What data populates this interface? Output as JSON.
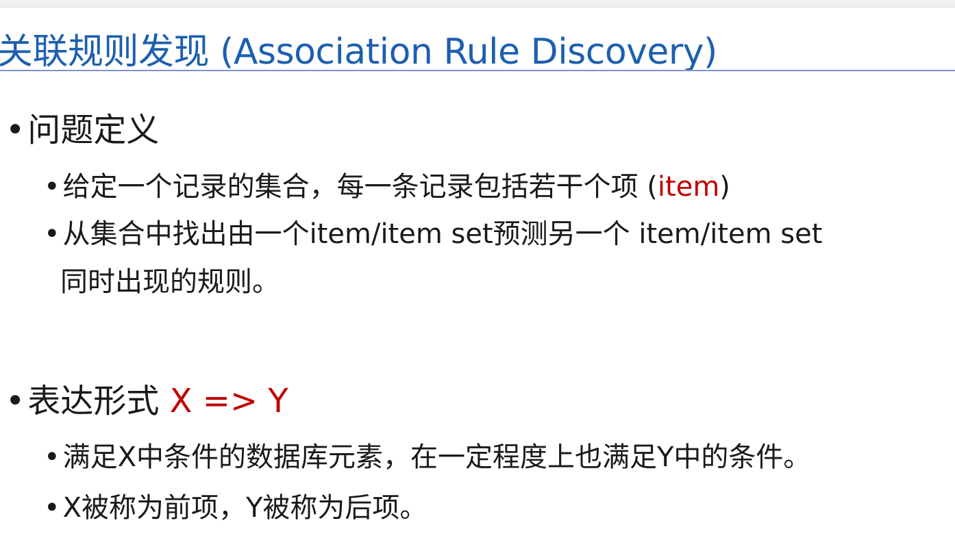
{
  "slide": {
    "title": "关联规则发现 (Association Rule Discovery)"
  },
  "section1": {
    "heading": "问题定义",
    "items": [
      {
        "text": "给定一个记录的集合，每一条记录包括若干个项 (",
        "highlight": "item",
        "suffix": ")"
      },
      {
        "line1": "从集合中找出由一个item/item set预测另一个 item/item set",
        "line2": "同时出现的规则。"
      }
    ]
  },
  "section2": {
    "heading": "表达形式 ",
    "formula": "X => Y",
    "items": [
      {
        "text": "满足X中条件的数据库元素，在一定程度上也满足Y中的条件。"
      },
      {
        "text": "X被称为前项，Y被称为后项。"
      }
    ]
  },
  "bullet_glyph": "•",
  "colors": {
    "title": "#1c5fb0",
    "title_rule": "#7f8fd6",
    "emphasis": "#c00000",
    "body_text": "#1a1a1a"
  }
}
